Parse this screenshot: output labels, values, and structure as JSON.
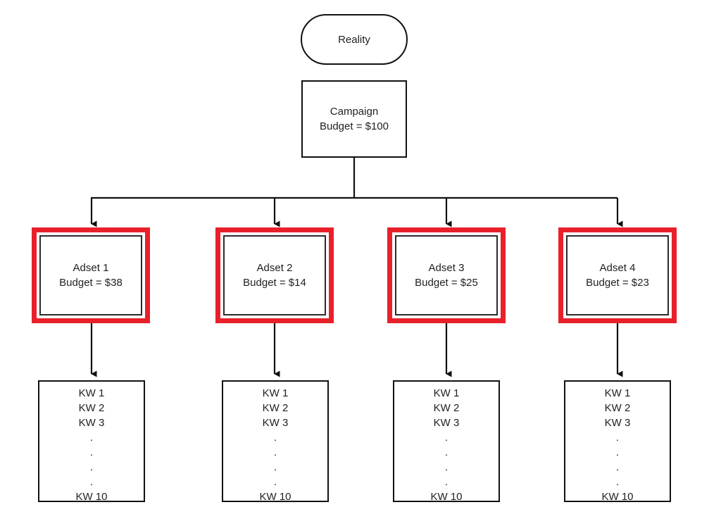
{
  "diagram": {
    "title": "Reality campaign budget allocation tree",
    "colors": {
      "highlight_red": "#e8202a",
      "stroke_black": "#111111",
      "text": "#1f1f1f",
      "background": "#ffffff"
    },
    "root": {
      "label": "Reality"
    },
    "campaign": {
      "name": "Campaign",
      "budget_label": "Budget = $100",
      "budget_value": 100,
      "currency": "$"
    },
    "adsets": [
      {
        "name": "Adset 1",
        "budget_label": "Budget = $38",
        "budget_value": 38,
        "highlighted": true
      },
      {
        "name": "Adset 2",
        "budget_label": "Budget = $14",
        "budget_value": 14,
        "highlighted": true
      },
      {
        "name": "Adset 3",
        "budget_label": "Budget = $25",
        "budget_value": 25,
        "highlighted": true
      },
      {
        "name": "Adset 4",
        "budget_label": "Budget = $23",
        "budget_value": 23,
        "highlighted": true
      }
    ],
    "keyword_groups": [
      {
        "lines": [
          "KW 1",
          "KW 2",
          "KW 3"
        ],
        "ellipsis_dots": 4,
        "last_line": "KW 10"
      },
      {
        "lines": [
          "KW 1",
          "KW 2",
          "KW 3"
        ],
        "ellipsis_dots": 4,
        "last_line": "KW 10"
      },
      {
        "lines": [
          "KW 1",
          "KW 2",
          "KW 3"
        ],
        "ellipsis_dots": 4,
        "last_line": "KW 10"
      },
      {
        "lines": [
          "KW 1",
          "KW 2",
          "KW 3"
        ],
        "ellipsis_dots": 4,
        "last_line": "KW 10"
      }
    ],
    "dot_glyph": "."
  }
}
